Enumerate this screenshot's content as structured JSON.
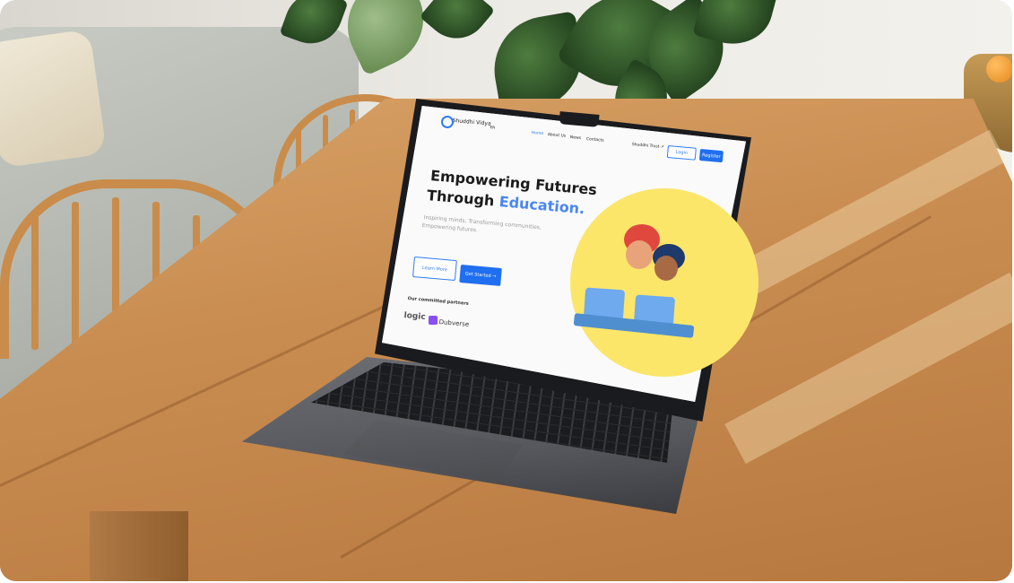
{
  "site": {
    "brand": "Shuddhi Vidya",
    "language": "EN",
    "nav": [
      "Home",
      "About Us",
      "News",
      "Contacts"
    ],
    "nav_active": "Home",
    "trust_link": "Shuddhi Trust ↗",
    "login_label": "Login",
    "register_label": "Register"
  },
  "hero": {
    "title_line1": "Empowering Futures",
    "title_line2_prefix": "Through ",
    "title_accent": "Education.",
    "subtitle_line1": "Inspiring minds, Transforming communities,",
    "subtitle_line2": "Empowering futures.",
    "learn_more_label": "Learn More",
    "get_started_label": "Get Started →"
  },
  "partners": {
    "title": "Our committed partners",
    "items": [
      "logic",
      "Dubverse"
    ]
  },
  "colors": {
    "accent": "#2f7cf6",
    "hero_circle": "#fbe66a",
    "table_wood": "#c98d51"
  }
}
